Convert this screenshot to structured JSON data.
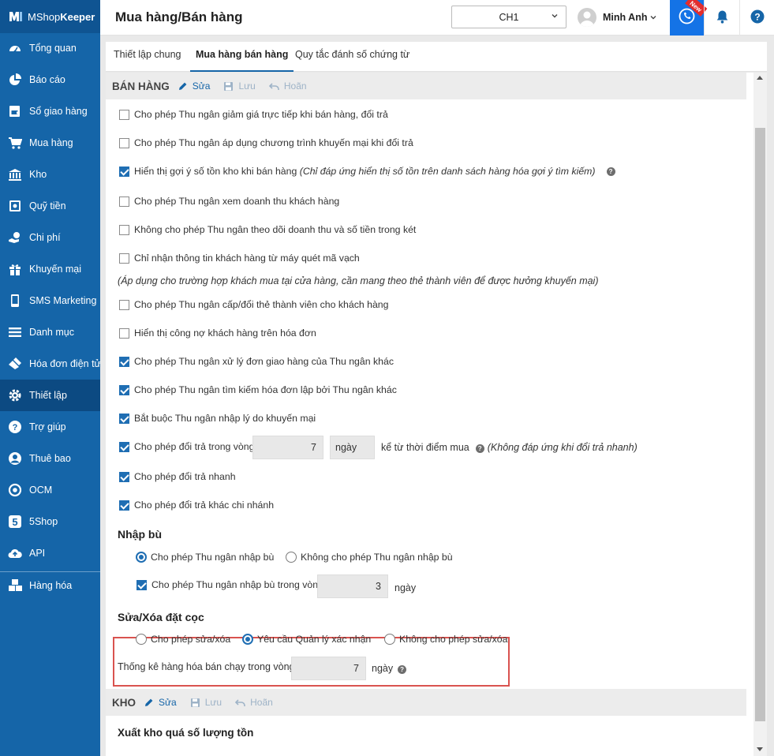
{
  "app": {
    "logo_light": "MShop",
    "logo_bold": "Keeper"
  },
  "sidebar": {
    "items": [
      {
        "label": "Tổng quan",
        "icon": "dashboard-icon"
      },
      {
        "label": "Báo cáo",
        "icon": "pie-chart-icon"
      },
      {
        "label": "Sổ giao hàng",
        "icon": "delivery-book-icon"
      },
      {
        "label": "Mua hàng",
        "icon": "cart-icon"
      },
      {
        "label": "Kho",
        "icon": "warehouse-icon"
      },
      {
        "label": "Quỹ tiền",
        "icon": "safe-icon"
      },
      {
        "label": "Chi phí",
        "icon": "expense-icon"
      },
      {
        "label": "Khuyến mại",
        "icon": "gift-icon"
      },
      {
        "label": "SMS Marketing",
        "icon": "phone-icon"
      },
      {
        "label": "Danh mục",
        "icon": "list-icon"
      },
      {
        "label": "Hóa đơn điện tử",
        "icon": "einvoice-icon"
      },
      {
        "label": "Thiết lập",
        "icon": "gear-icon",
        "active": true
      },
      {
        "label": "Trợ giúp",
        "icon": "help-icon"
      },
      {
        "label": "Thuê bao",
        "icon": "user-icon"
      },
      {
        "label": "OCM",
        "icon": "ocm-icon"
      },
      {
        "label": "5Shop",
        "icon": "5shop-icon"
      },
      {
        "label": "API",
        "icon": "cloud-upload-icon"
      },
      {
        "label": "Hàng hóa",
        "icon": "boxes-icon"
      }
    ]
  },
  "header": {
    "title": "Mua hàng/Bán hàng",
    "branch": "CH1",
    "user": "Minh Anh",
    "new_badge": "New"
  },
  "tabs": [
    {
      "label": "Thiết lập chung",
      "active": false
    },
    {
      "label": "Mua hàng bán hàng",
      "active": true
    },
    {
      "label": "Quy tắc đánh số chứng từ",
      "active": false
    }
  ],
  "sales": {
    "title": "BÁN HÀNG",
    "edit": "Sửa",
    "save": "Lưu",
    "undo": "Hoãn",
    "options": [
      {
        "label": "Cho phép Thu ngân giảm giá trực tiếp khi bán hàng, đổi trả",
        "checked": false
      },
      {
        "label": "Cho phép Thu ngân áp dụng chương trình khuyến mại khi đổi trả",
        "checked": false
      },
      {
        "label": "Hiển thị gợi ý số tồn kho khi bán hàng",
        "note": "(Chỉ đáp ứng hiển thị số tồn trên danh sách hàng hóa gợi ý tìm kiếm)",
        "checked": true
      },
      {
        "label": "Cho phép Thu ngân xem doanh thu khách hàng",
        "checked": false
      },
      {
        "label": "Không cho phép Thu ngân theo dõi doanh thu và số tiền trong két",
        "checked": false
      },
      {
        "label": "Chỉ nhận thông tin khách hàng từ máy quét mã vạch",
        "checked": false
      },
      {
        "label": "Cho phép Thu ngân cấp/đổi thẻ thành viên cho khách hàng",
        "checked": false
      },
      {
        "label": "Hiển thị công nợ khách hàng trên hóa đơn",
        "checked": false
      },
      {
        "label": "Cho phép Thu ngân xử lý đơn giao hàng của Thu ngân khác",
        "checked": true
      },
      {
        "label": "Cho phép Thu ngân tìm kiếm hóa đơn lập bởi Thu ngân khác",
        "checked": true
      },
      {
        "label": "Bắt buộc Thu ngân nhập lý do khuyến mại",
        "checked": true
      },
      {
        "label": "Cho phép đổi trả trong vòng",
        "checked": true
      },
      {
        "label": "Cho phép đổi trả nhanh",
        "checked": true
      },
      {
        "label": "Cho phép đổi trả khác chi nhánh",
        "checked": true
      }
    ],
    "barcode_note": "(Áp dụng cho trường hợp khách mua tại cửa hàng, cần mang theo thẻ thành viên để được hưởng khuyến mại)",
    "return_days": "7",
    "return_unit": "ngày",
    "return_from": "kể từ thời điểm mua",
    "return_note": "(Không đáp ứng khi đổi trả nhanh)",
    "restock": {
      "title": "Nhập bù",
      "options": [
        {
          "label": "Cho phép Thu ngân nhập bù",
          "selected": true
        },
        {
          "label": "Không cho phép Thu ngân nhập bù",
          "selected": false
        }
      ],
      "within_label": "Cho phép Thu ngân nhập bù trong vòng",
      "within_checked": true,
      "within_days": "3",
      "within_unit": "ngày"
    },
    "deposit": {
      "title": "Sửa/Xóa đặt cọc",
      "options": [
        {
          "label": "Cho phép sửa/xóa",
          "selected": false
        },
        {
          "label": "Yêu cầu Quản lý xác nhận",
          "selected": true
        },
        {
          "label": "Không cho phép sửa/xóa",
          "selected": false
        }
      ]
    },
    "bestseller_label": "Thống kê hàng hóa bán chạy trong vòng",
    "bestseller_days": "7",
    "bestseller_unit": "ngày"
  },
  "warehouse": {
    "title": "KHO",
    "edit": "Sửa",
    "save": "Lưu",
    "undo": "Hoãn",
    "export_over_label": "Xuất kho quá số lượng tồn"
  }
}
